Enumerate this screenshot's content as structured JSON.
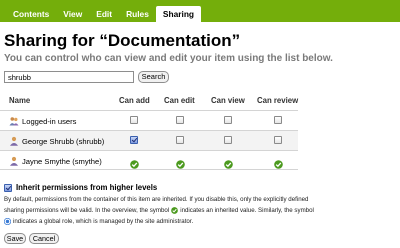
{
  "tabs": [
    {
      "label": "Contents",
      "active": false
    },
    {
      "label": "View",
      "active": false
    },
    {
      "label": "Edit",
      "active": false
    },
    {
      "label": "Rules",
      "active": false
    },
    {
      "label": "Sharing",
      "active": true
    }
  ],
  "page": {
    "title": "Sharing for “Documentation”",
    "subtitle": "You can control who can view and edit your item using the list below."
  },
  "search": {
    "value": "shrubb",
    "button_label": "Search"
  },
  "table": {
    "columns": [
      "Name",
      "Can add",
      "Can edit",
      "Can view",
      "Can review"
    ],
    "rows": [
      {
        "name": "Logged-in users",
        "icon": "group-icon",
        "highlighted": false,
        "cells": [
          "checkbox",
          "checkbox",
          "checkbox",
          "checkbox"
        ]
      },
      {
        "name": "George Shrubb (shrubb)",
        "icon": "user-icon",
        "highlighted": true,
        "cells": [
          "checkbox-checked",
          "checkbox",
          "checkbox",
          "checkbox"
        ]
      },
      {
        "name": "Jayne Smythe (smythe)",
        "icon": "user-icon",
        "highlighted": false,
        "cells": [
          "inherited-check",
          "inherited-check",
          "inherited-check",
          "inherited-check"
        ]
      }
    ]
  },
  "inherit": {
    "checked": true,
    "label": "Inherit permissions from higher levels",
    "desc_line1": "By default, permissions from the container of this item are inherited. If you disable this, only the explicitly defined",
    "desc_line2a": "sharing permissions will be valid. In the overview, the symbol",
    "desc_line2b": "indicates an inherited value. Similarly, the symbol",
    "desc_line3": "indicates a global role, which is managed by the site administrator."
  },
  "buttons": {
    "save": "Save",
    "cancel": "Cancel"
  },
  "colors": {
    "tab_bar": "#74ae0b",
    "inherited_check": "#4c9a1f",
    "global_role": "#3a7bd5"
  }
}
